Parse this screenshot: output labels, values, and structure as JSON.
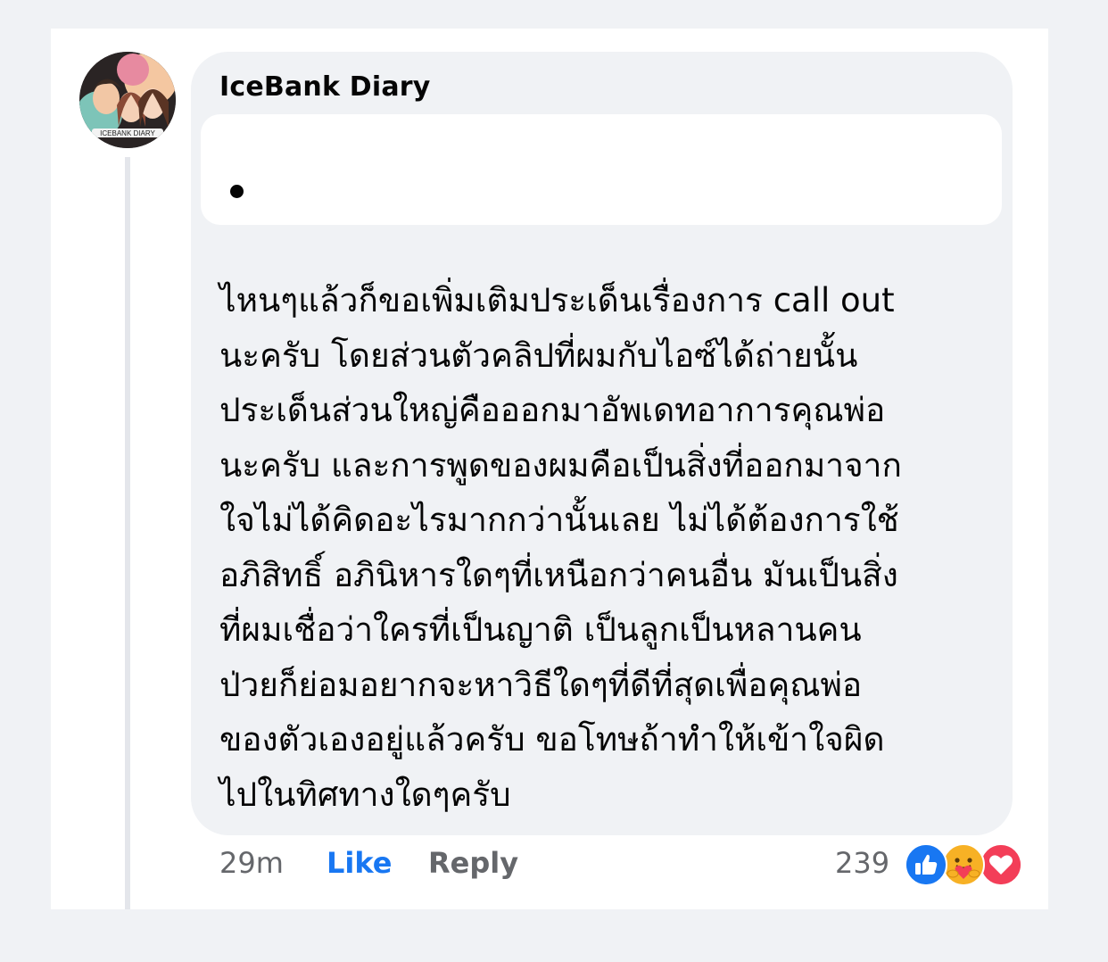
{
  "comment": {
    "author": "IceBank Diary",
    "avatar_text": "ICEBANK DIARY",
    "lines": [
      "ไหนๆแล้วก็ขอเพิ่มเติมประเด็นเรื่องการ call out",
      "นะครับ โดยส่วนตัวคลิปที่ผมกับไอซ์ได้ถ่ายนั้น",
      "ประเด็นส่วนใหญ่คือออกมาอัพเดทอาการคุณพ่อ",
      "นะครับ และการพูดของผมคือเป็นสิ่งที่ออกมาจาก",
      "ใจไม่ได้คิดอะไรมากกว่านั้นเลย ไม่ได้ต้องการใช้",
      "อภิสิทธิ์ อภินิหารใดๆที่เหนือกว่าคนอื่น มันเป็นสิ่ง",
      "ที่ผมเชื่อว่าใครที่เป็นญาติ เป็นลูกเป็นหลานคน",
      "ป่วยก็ย่อมอยากจะหาวิธีใดๆที่ดีที่สุดเพื่อคุณพ่อ",
      "ของตัวเองอยู่แล้วครับ ขอโทษถ้าทำให้เข้าใจผิด",
      "ไปในทิศทางใดๆครับ"
    ]
  },
  "actions": {
    "time": "29m",
    "like": "Like",
    "reply": "Reply"
  },
  "reactions": {
    "count": "239",
    "icons": [
      "like-icon",
      "care-icon",
      "love-icon"
    ],
    "colors": {
      "like": "#1877f2",
      "care": "#f7b125",
      "love": "#f33e58"
    }
  },
  "colors": {
    "accent": "#1877f2",
    "bubble": "#f0f2f5",
    "secondary_text": "#65676b"
  }
}
